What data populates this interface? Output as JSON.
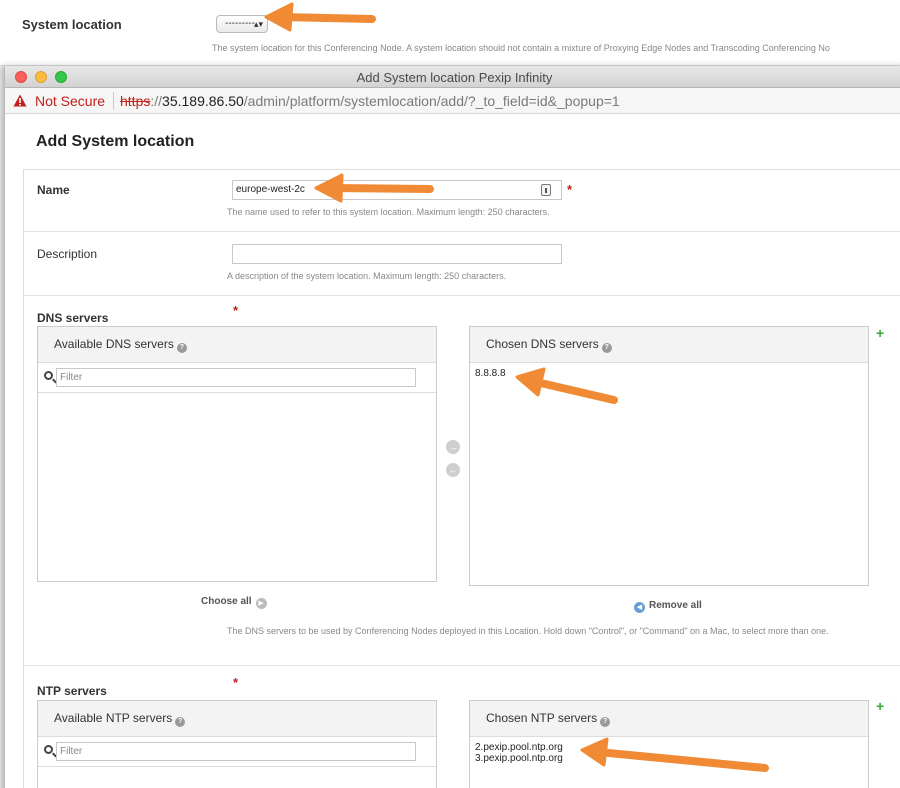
{
  "background_page": {
    "label": "System location",
    "select_value": "---------",
    "help_text": "The system location for this Conferencing Node. A system location should not contain a mixture of Proxying Edge Nodes and Transcoding Conferencing No"
  },
  "window": {
    "title": "Add System location Pexip Infinity",
    "security_label": "Not Secure",
    "url_scheme": "https",
    "url_scheme_sep": "://",
    "url_host": "35.189.86.50",
    "url_path": "/admin/platform/systemlocation/add/?_to_field=id&_popup=1"
  },
  "page": {
    "title": "Add System location"
  },
  "form": {
    "name": {
      "label": "Name",
      "value": "europe-west-2c",
      "required_mark": "*",
      "help": "The name used to refer to this system location. Maximum length: 250 characters."
    },
    "description": {
      "label": "Description",
      "value": "",
      "help": "A description of the system location. Maximum length: 250 characters."
    },
    "dns": {
      "label": "DNS servers",
      "required_mark": "*",
      "available_title": "Available DNS servers",
      "chosen_title": "Chosen DNS servers",
      "filter_placeholder": "Filter",
      "chosen": [
        "8.8.8.8"
      ],
      "choose_all": "Choose all",
      "remove_all": "Remove all",
      "help": "The DNS servers to be used by Conferencing Nodes deployed in this Location. Hold down \"Control\", or \"Command\" on a Mac, to select more than one."
    },
    "ntp": {
      "label": "NTP servers",
      "required_mark": "*",
      "available_title": "Available NTP servers",
      "chosen_title": "Chosen NTP servers",
      "filter_placeholder": "Filter",
      "chosen": [
        "2.pexip.pool.ntp.org",
        "3.pexip.pool.ntp.org"
      ]
    }
  },
  "icons": {
    "help": "?",
    "add": "+",
    "move_right": "→",
    "move_left": "←"
  },
  "colors": {
    "annotation_arrow": "#f08a35",
    "required": "#c4201a",
    "add_green": "#3aa83a"
  }
}
